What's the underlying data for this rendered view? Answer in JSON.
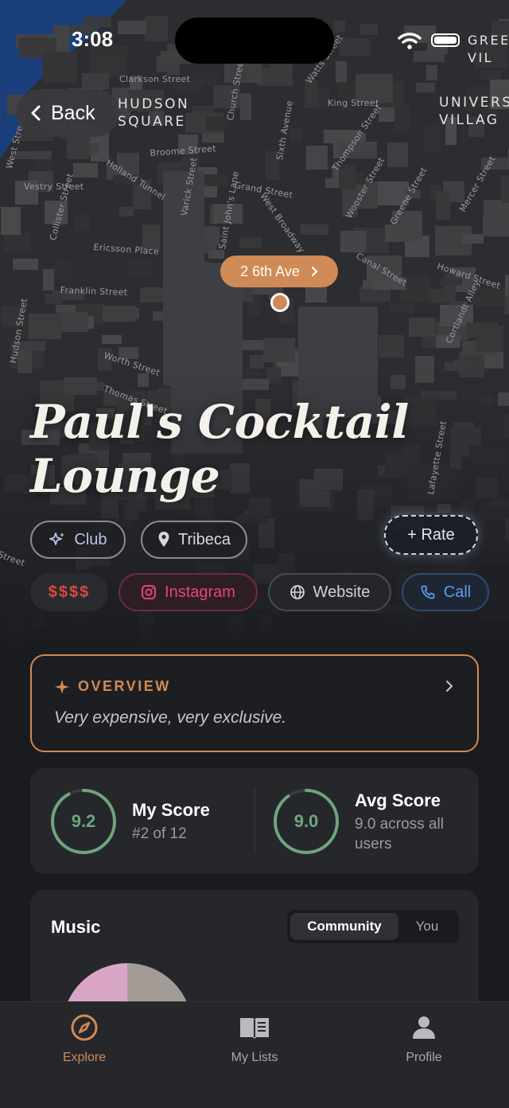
{
  "status_bar": {
    "time": "3:08",
    "carrier_label": "GREE\nVIL"
  },
  "map": {
    "neighborhoods": [
      {
        "label": "HUDSON\nSQUARE"
      },
      {
        "label": "UNIVERS\nVILLAG"
      }
    ],
    "streets": [
      "Vestry Street",
      "Broome Street",
      "Holland Tunnel",
      "Grand Street",
      "Ericsson Place",
      "Franklin Street",
      "Worth Street",
      "Thomas Street",
      "Canal Street",
      "Howard Street",
      "Varick Street",
      "Lafayette Street",
      "Hudson Street",
      "Church Street",
      "West Broadway",
      "Wooster Street",
      "Greene Street",
      "Mercer Street",
      "Cortlandt Alley",
      "Collister Street",
      "Saint John's Lane",
      "Sixth Avenue",
      "Thompson Street",
      "Watts Street",
      "Clarkson Street",
      "King Street",
      "West Street",
      "Street"
    ],
    "pin_label": "2 6th Ave",
    "accent_color": "#d08a55"
  },
  "nav": {
    "back_label": "Back"
  },
  "venue": {
    "title": "Paul's Cocktail Lounge",
    "category": "Club",
    "neighborhood": "Tribeca",
    "rate_label": "+ Rate",
    "price": "$$$$",
    "links": {
      "instagram": "Instagram",
      "website": "Website",
      "call": "Call"
    }
  },
  "overview": {
    "heading": "OVERVIEW",
    "text": "Very expensive, very exclusive."
  },
  "scores": {
    "mine": {
      "value": "9.2",
      "progress": 0.92,
      "title": "My Score",
      "subtitle": "#2 of 12"
    },
    "avg": {
      "value": "9.0",
      "progress": 0.9,
      "title": "Avg Score",
      "subtitle": "9.0 across all users"
    },
    "ring_color": "#6ea57d"
  },
  "music": {
    "title": "Music",
    "segments": [
      "Community",
      "You"
    ],
    "selected_segment": "Community",
    "pie_colors": [
      "#d9a6c8",
      "#a39c96"
    ]
  },
  "tabbar": {
    "tabs": [
      {
        "label": "Explore",
        "icon": "compass-icon",
        "active": true
      },
      {
        "label": "My Lists",
        "icon": "book-icon",
        "active": false
      },
      {
        "label": "Profile",
        "icon": "person-icon",
        "active": false
      }
    ]
  }
}
